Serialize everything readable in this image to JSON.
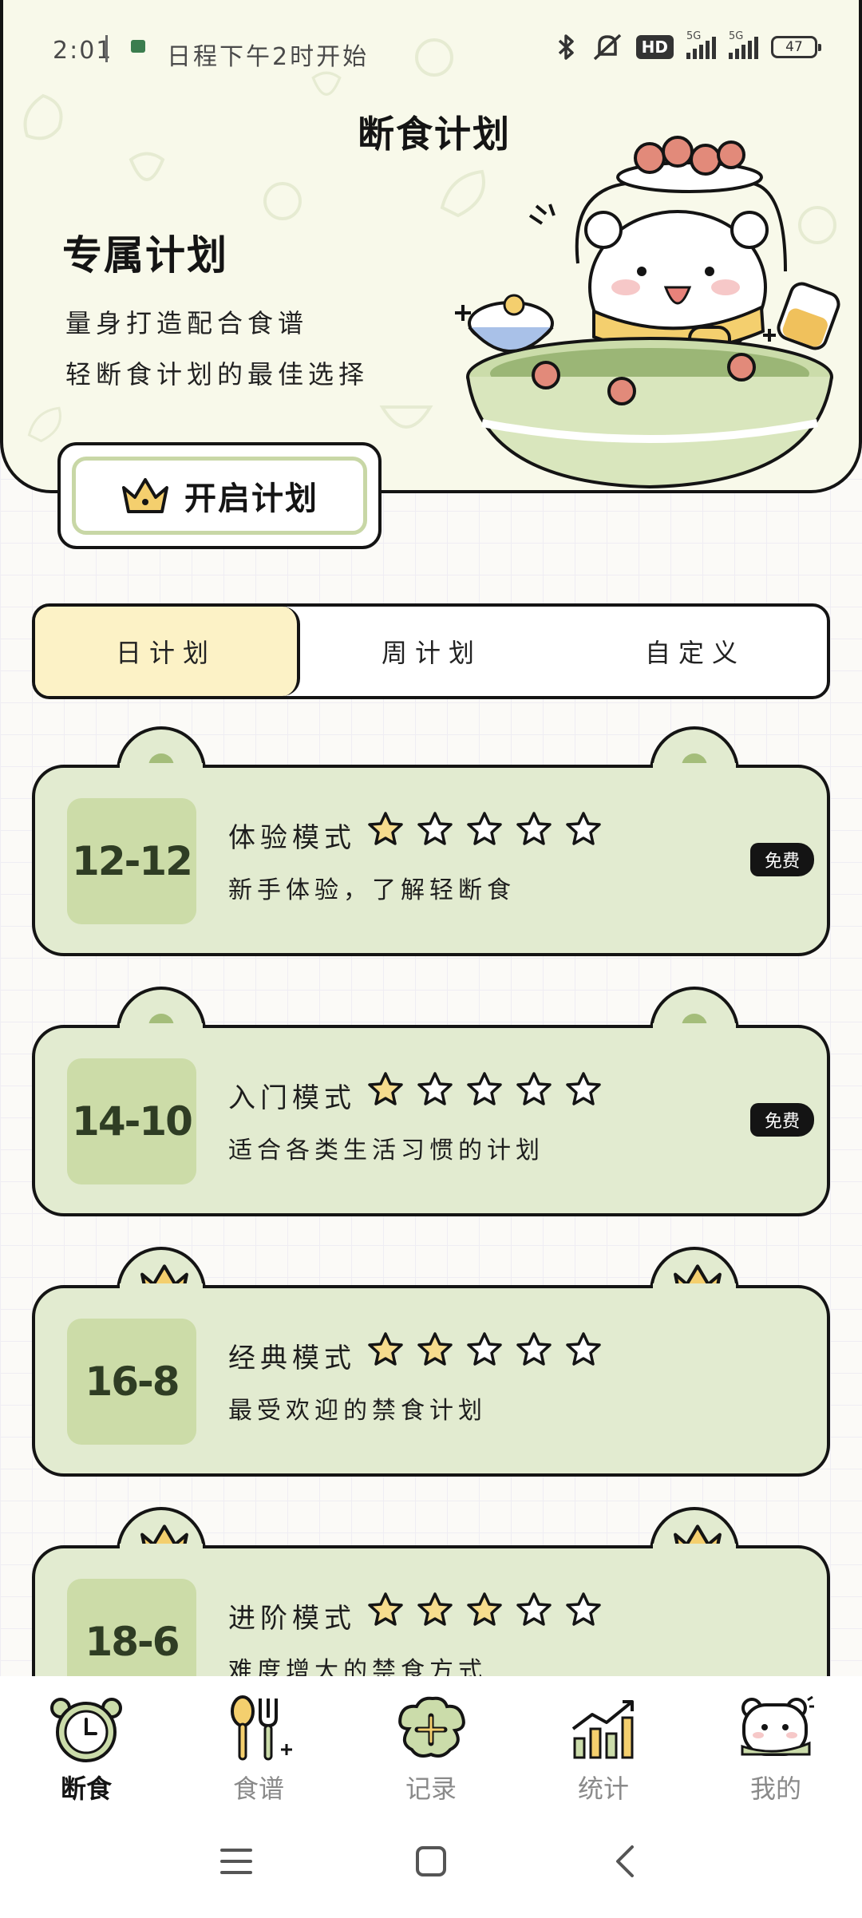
{
  "status_bar": {
    "time": "2:01",
    "notification": "日程下午2时开始",
    "hd": "HD",
    "signal": "5G",
    "battery": "47"
  },
  "hero": {
    "title": "断食计划",
    "plan_title": "专属计划",
    "desc_line1": "量身打造配合食谱",
    "desc_line2": "轻断食计划的最佳选择",
    "cta_label": "开启计划"
  },
  "tabs": [
    {
      "label": "日计划",
      "active": true
    },
    {
      "label": "周计划",
      "active": false
    },
    {
      "label": "自定义",
      "active": false
    }
  ],
  "plans": [
    {
      "ratio": "12-12",
      "name": "体验模式",
      "stars": 1,
      "desc": "新手体验，了解轻断食",
      "badge": "免费",
      "ear": "dot"
    },
    {
      "ratio": "14-10",
      "name": "入门模式",
      "stars": 1,
      "desc": "适合各类生活习惯的计划",
      "badge": "免费",
      "ear": "dot"
    },
    {
      "ratio": "16-8",
      "name": "经典模式",
      "stars": 2,
      "desc": "最受欢迎的禁食计划",
      "badge": "",
      "ear": "crown"
    },
    {
      "ratio": "18-6",
      "name": "进阶模式",
      "stars": 3,
      "desc": "难度增大的禁食方式",
      "badge": "",
      "ear": "crown"
    }
  ],
  "nav": [
    {
      "label": "断食",
      "icon": "clock-icon",
      "active": true
    },
    {
      "label": "食谱",
      "icon": "spoon-fork-icon",
      "active": false
    },
    {
      "label": "记录",
      "icon": "add-record-icon",
      "active": false
    },
    {
      "label": "统计",
      "icon": "chart-icon",
      "active": false
    },
    {
      "label": "我的",
      "icon": "bear-profile-icon",
      "active": false
    }
  ],
  "colors": {
    "card_bg": "#e2ebd0",
    "ratio_bg": "#ccdca8",
    "tab_active": "#fcf2c6",
    "star_filled": "#f6dc8e",
    "outline": "#141414"
  }
}
